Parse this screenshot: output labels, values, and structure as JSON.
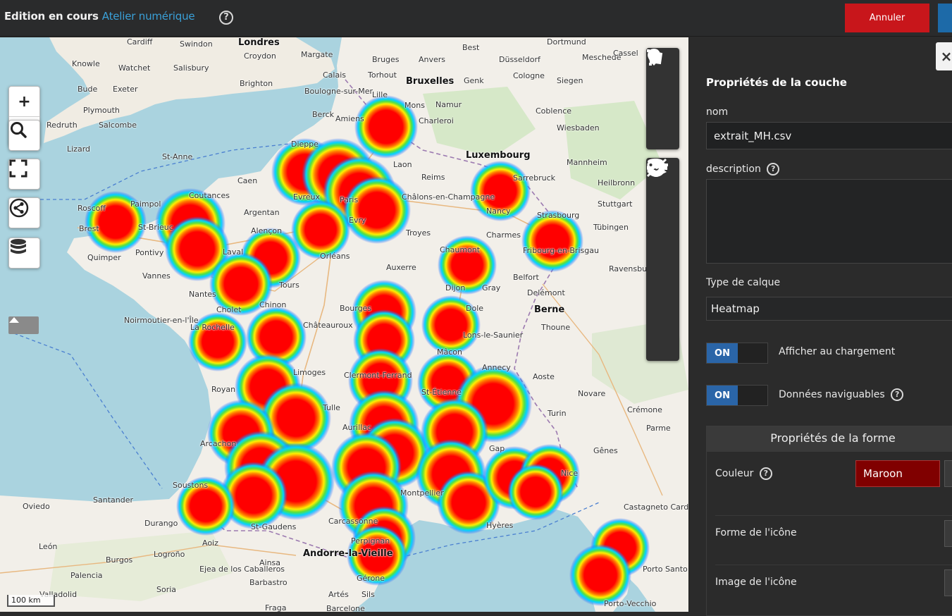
{
  "header": {
    "status": "Edition en cours",
    "map_name": "Atelier numérique",
    "cancel_label": "Annuler"
  },
  "map": {
    "scale_label": "100 km",
    "places": [
      {
        "name": "Londres",
        "big": true
      },
      {
        "name": "Bruxelles",
        "big": true
      },
      {
        "name": "Luxembourg",
        "big": true
      },
      {
        "name": "Berne",
        "big": true
      },
      {
        "name": "Andorre-la-Vieille",
        "big": true
      },
      {
        "name": "Cardiff"
      },
      {
        "name": "Swindon"
      },
      {
        "name": "Croydon"
      },
      {
        "name": "Margate"
      },
      {
        "name": "Bruges"
      },
      {
        "name": "Anvers"
      },
      {
        "name": "Best"
      },
      {
        "name": "Düsseldorf"
      },
      {
        "name": "Dortmund"
      },
      {
        "name": "Meschede"
      },
      {
        "name": "Cassel"
      },
      {
        "name": "Knowle"
      },
      {
        "name": "Watchet"
      },
      {
        "name": "Salisbury"
      },
      {
        "name": "Torhout"
      },
      {
        "name": "Genk"
      },
      {
        "name": "Cologne"
      },
      {
        "name": "Siegen"
      },
      {
        "name": "Bude"
      },
      {
        "name": "Exeter"
      },
      {
        "name": "Brighton"
      },
      {
        "name": "Calais"
      },
      {
        "name": "Lille"
      },
      {
        "name": "Mons"
      },
      {
        "name": "Namur"
      },
      {
        "name": "Coblence"
      },
      {
        "name": "Plymouth"
      },
      {
        "name": "Salcombe"
      },
      {
        "name": "Redruth"
      },
      {
        "name": "Boulogne-sur-Mer"
      },
      {
        "name": "Berck"
      },
      {
        "name": "Amiens"
      },
      {
        "name": "Charleroi"
      },
      {
        "name": "Wiesbaden"
      },
      {
        "name": "Lizard"
      },
      {
        "name": "St-Anne"
      },
      {
        "name": "Dieppe"
      },
      {
        "name": "Laon"
      },
      {
        "name": "Mannheim"
      },
      {
        "name": "Caen"
      },
      {
        "name": "Evreux"
      },
      {
        "name": "Paris"
      },
      {
        "name": "Reims"
      },
      {
        "name": "Sarrebruck"
      },
      {
        "name": "Heilbronn"
      },
      {
        "name": "Coutances"
      },
      {
        "name": "Argentan"
      },
      {
        "name": "Châlons-en-Champagne"
      },
      {
        "name": "Nancy"
      },
      {
        "name": "Stuttgart"
      },
      {
        "name": "Roscoff"
      },
      {
        "name": "Paimpol"
      },
      {
        "name": "St-Brieuc"
      },
      {
        "name": "Alençon"
      },
      {
        "name": "Evry"
      },
      {
        "name": "Troyes"
      },
      {
        "name": "Strasbourg"
      },
      {
        "name": "Tübingen"
      },
      {
        "name": "Brest"
      },
      {
        "name": "Quimper"
      },
      {
        "name": "Laval"
      },
      {
        "name": "Orléans"
      },
      {
        "name": "Charmes"
      },
      {
        "name": "Fribourg-en-Brisgau"
      },
      {
        "name": "Pontivy"
      },
      {
        "name": "Vannes"
      },
      {
        "name": "Tours"
      },
      {
        "name": "Auxerre"
      },
      {
        "name": "Chaumont"
      },
      {
        "name": "Belfort"
      },
      {
        "name": "Nantes"
      },
      {
        "name": "Chinon"
      },
      {
        "name": "Dijon"
      },
      {
        "name": "Gray"
      },
      {
        "name": "Ravensburg"
      },
      {
        "name": "Cholet"
      },
      {
        "name": "Bourges"
      },
      {
        "name": "Dole"
      },
      {
        "name": "Delémont"
      },
      {
        "name": "Noirmoutier-en-l'Île"
      },
      {
        "name": "La Rochelle"
      },
      {
        "name": "Châteauroux"
      },
      {
        "name": "Lons-le-Saunier"
      },
      {
        "name": "Thoune"
      },
      {
        "name": "Mâcon"
      },
      {
        "name": "Limoges"
      },
      {
        "name": "Clermont-Ferrand"
      },
      {
        "name": "Annecy"
      },
      {
        "name": "Royan"
      },
      {
        "name": "Tulle"
      },
      {
        "name": "St-Étienne"
      },
      {
        "name": "Aoste"
      },
      {
        "name": "Novare"
      },
      {
        "name": "Crémone"
      },
      {
        "name": "Arcachon"
      },
      {
        "name": "Aurillac"
      },
      {
        "name": "Turin"
      },
      {
        "name": "Parme"
      },
      {
        "name": "Gap"
      },
      {
        "name": "Gênes"
      },
      {
        "name": "Soustons"
      },
      {
        "name": "Santander"
      },
      {
        "name": "Nice"
      },
      {
        "name": "Oviedo"
      },
      {
        "name": "Montpellier"
      },
      {
        "name": "Hyères"
      },
      {
        "name": "Castagneto Carducci"
      },
      {
        "name": "Durango"
      },
      {
        "name": "Aoiz"
      },
      {
        "name": "Carcassonne"
      },
      {
        "name": "St-Gaudens"
      },
      {
        "name": "León"
      },
      {
        "name": "Logroño"
      },
      {
        "name": "Perpignan"
      },
      {
        "name": "Burgos"
      },
      {
        "name": "Ejea de los Caballeros"
      },
      {
        "name": "Ainsa"
      },
      {
        "name": "Porto Santo Stefano"
      },
      {
        "name": "Palencia"
      },
      {
        "name": "Soria"
      },
      {
        "name": "Gérone"
      },
      {
        "name": "Valladolid"
      },
      {
        "name": "Barbastro"
      },
      {
        "name": "Artés"
      },
      {
        "name": "Sils"
      },
      {
        "name": "Porto-Vecchio"
      },
      {
        "name": "Fraga"
      },
      {
        "name": "Barcelone"
      }
    ]
  },
  "panel": {
    "title": "Propriétés de la couche",
    "name_label": "nom",
    "name_value": "extrait_MH.csv",
    "description_label": "description",
    "description_value": "",
    "layer_type_label": "Type de calque",
    "layer_type_value": "Heatmap",
    "switch_on": "ON",
    "show_on_load_label": "Afficher au chargement",
    "browsable_label": "Données naviguables",
    "shape_header": "Propriétés de la forme",
    "color_label": "Couleur",
    "color_value": "Maroon",
    "icon_shape_label": "Forme de l'icône",
    "icon_image_label": "Image de l'icône"
  },
  "colors": {
    "heat_core": "#ff0000",
    "accent_blue": "#3aa0d8",
    "cancel_red": "#c8161b",
    "switch_blue": "#2a65a8",
    "maroon": "#800000"
  },
  "icons": {
    "toolbar": [
      "marker-icon",
      "polyline-icon",
      "polygon-icon",
      "upload-icon",
      "gear-icon",
      "layers-icon",
      "database-icon",
      "link-icon",
      "key-icon"
    ],
    "map_controls": [
      "zoom-in",
      "zoom-out",
      "search-icon",
      "fullscreen-icon",
      "share-icon",
      "database-icon",
      "caret-up-icon"
    ]
  }
}
